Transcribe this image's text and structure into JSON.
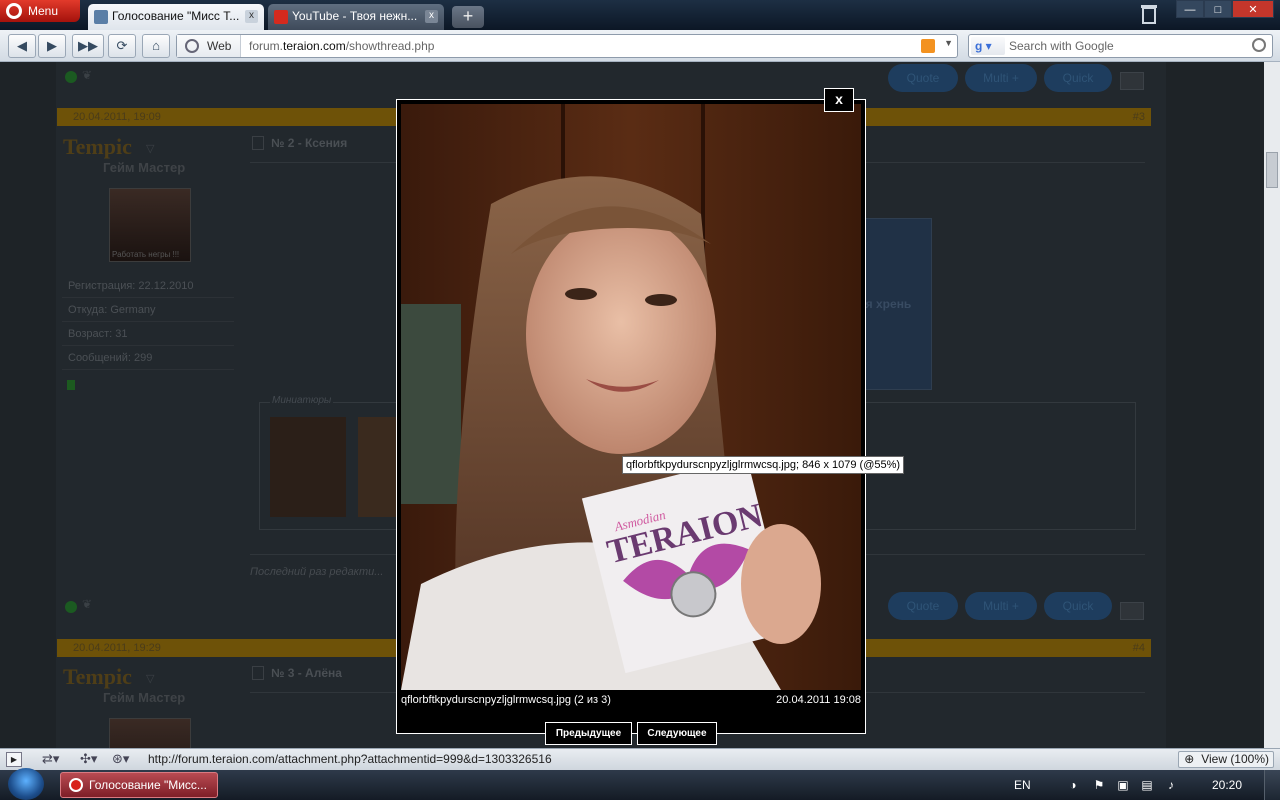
{
  "browser": {
    "menu_label": "Menu",
    "tabs": [
      {
        "title": "Голосование \"Мисс Т...",
        "close": "x"
      },
      {
        "title": "YouTube - Твоя нежн...",
        "close": "x"
      }
    ],
    "newtab": "+",
    "window_controls": {
      "minimize": "—",
      "maximize": "□",
      "close": "✕"
    },
    "address": {
      "protocol_label": "Web",
      "url_prefix": "forum.",
      "url_domain": "teraion.com",
      "url_path": "/showthread.php"
    },
    "search_placeholder": "Search with Google"
  },
  "forum": {
    "posts": [
      {
        "date": "20.04.2011, 19:09",
        "number": "#3",
        "username": "Tempic",
        "rank": "Гейм Мастер",
        "avatar_caption": "Работать негры !!!",
        "info": [
          "Регистрация: 22.12.2010",
          "Откуда: Germany",
          "Возраст: 31",
          "Сообщений: 299"
        ],
        "title": "№ 2 - Ксения",
        "table_fragment": "ая хрень",
        "thumbnails_legend": "Миниатюры",
        "last_edited": "Последний раз редакти..."
      },
      {
        "date": "20.04.2011, 19:29",
        "number": "#4",
        "username": "Tempic",
        "rank": "Гейм Мастер",
        "title": "№ 3 - Алёна"
      }
    ],
    "post_buttons": {
      "quote": "Quote",
      "multi": "Multi +",
      "quick": "Quick"
    }
  },
  "lightbox": {
    "close": "x",
    "filename_caption": "qflorbftkpydurscnpyzljglrmwcsq.jpg (2 из 3)",
    "date": "20.04.2011 19:08",
    "tooltip": "qflorbftkpydurscnpyzljglrmwcsq.jpg; 846 x 1079 (@55%)",
    "prev_label": "Предыдущее",
    "next_label": "Следующее",
    "card_text": "TERAION",
    "card_subtitle": "Asmodian"
  },
  "statusbar": {
    "url": "http://forum.teraion.com/attachment.php?attachmentid=999&d=1303326516",
    "zoom": "View (100%)"
  },
  "taskbar": {
    "task_label": "Голосование \"Мисс...",
    "lang": "EN",
    "time": "20:20"
  }
}
